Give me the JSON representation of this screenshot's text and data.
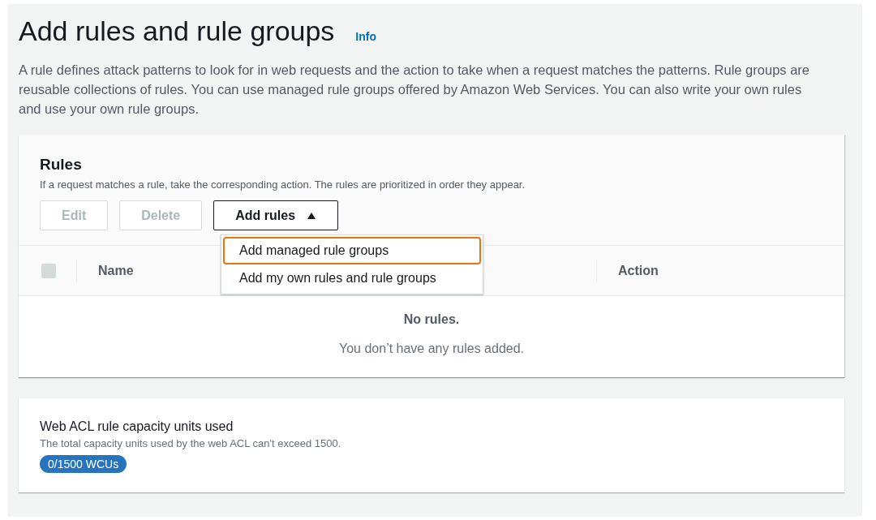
{
  "page": {
    "title": "Add rules and rule groups",
    "info_link": "Info",
    "description": "A rule defines attack patterns to look for in web requests and the action to take when a request matches the patterns. Rule groups are reusable collections of rules. You can use managed rule groups offered by Amazon Web Services. You can also write your own rules and use your own rule groups."
  },
  "rules_panel": {
    "title": "Rules",
    "description": "If a request matches a rule, take the corresponding action. The rules are prioritized in order they appear.",
    "buttons": [
      {
        "label": "Edit",
        "disabled": true
      },
      {
        "label": "Delete",
        "disabled": true
      }
    ],
    "add_rules": {
      "label": "Add rules",
      "expanded": true,
      "menu": [
        {
          "label": "Add managed rule groups",
          "selected": true
        },
        {
          "label": "Add my own rules and rule groups",
          "selected": false
        }
      ]
    },
    "select_all": {
      "checked": false,
      "disabled": true
    },
    "columns": [
      "Name",
      "Action"
    ],
    "empty_title": "No rules.",
    "empty_message": "You don’t have any rules added."
  },
  "capacity_panel": {
    "title": "Web ACL rule capacity units used",
    "description": "The total capacity units used by the web ACL can't exceed 1500.",
    "badge": "0/1500 WCUs"
  }
}
